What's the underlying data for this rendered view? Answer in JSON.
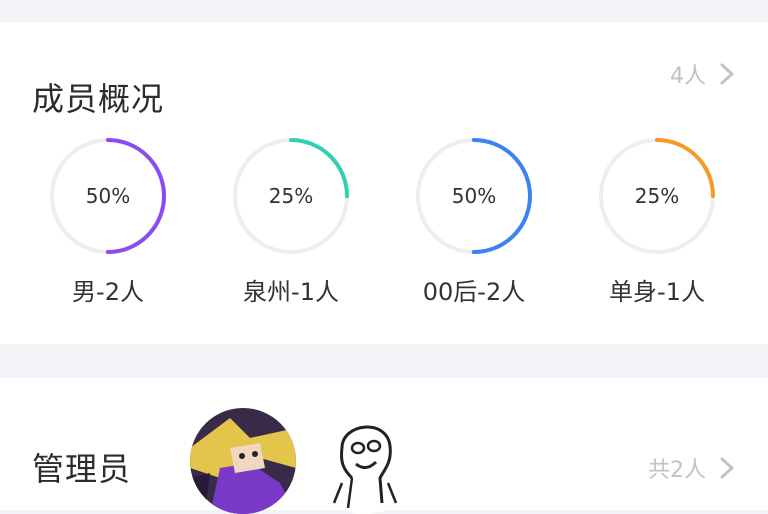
{
  "overview": {
    "title": "成员概况",
    "count_label": "4人",
    "stats": [
      {
        "percent_label": "50%",
        "percent": 50,
        "label": "男-2人",
        "color": "#8a4cf0"
      },
      {
        "percent_label": "25%",
        "percent": 25,
        "label": "泉州-1人",
        "color": "#2ed1b4"
      },
      {
        "percent_label": "50%",
        "percent": 50,
        "label": "00后-2人",
        "color": "#3b83f0"
      },
      {
        "percent_label": "25%",
        "percent": 25,
        "label": "单身-1人",
        "color": "#f59a28"
      }
    ]
  },
  "admins": {
    "title": "管理员",
    "count_label": "共2人",
    "avatars": [
      {
        "icon": "anime-character-avatar"
      },
      {
        "icon": "meme-face-avatar"
      }
    ]
  },
  "colors": {
    "background": "#f3f4f7",
    "card": "#ffffff",
    "muted": "#c2c2c2",
    "track": "#eeeeee"
  }
}
